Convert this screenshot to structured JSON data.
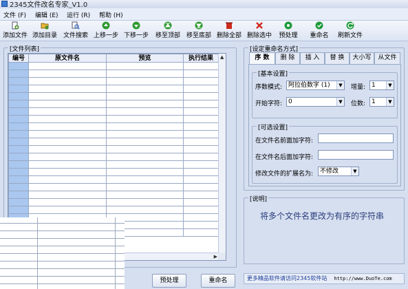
{
  "window": {
    "title": "2345文件改名专家_V1.0"
  },
  "menu": [
    {
      "label": "文件 (F)"
    },
    {
      "label": "编辑 (E)"
    },
    {
      "label": "运行 (R)"
    },
    {
      "label": "帮助 (H)"
    }
  ],
  "toolbar": [
    {
      "label": "添加文件",
      "icon": "add-file-icon",
      "color": "#4a8f2b"
    },
    {
      "label": "添加目录",
      "icon": "add-folder-icon",
      "color": "#d6a22a"
    },
    {
      "label": "文件搜索",
      "icon": "file-search-icon",
      "color": "#3567c4"
    },
    {
      "label": "上移一步",
      "icon": "arrow-up-icon",
      "color": "#2f9a2f"
    },
    {
      "label": "下移一步",
      "icon": "arrow-down-icon",
      "color": "#2f9a2f"
    },
    {
      "label": "移至顶部",
      "icon": "move-top-icon",
      "color": "#2f9a2f"
    },
    {
      "label": "移至底部",
      "icon": "move-bottom-icon",
      "color": "#2f9a2f"
    },
    {
      "label": "删除全部",
      "icon": "delete-all-icon",
      "color": "#cc2a1c"
    },
    {
      "label": "删除选中",
      "icon": "delete-selected-icon",
      "color": "#d0291f"
    },
    {
      "label": "预处理",
      "icon": "preprocess-icon",
      "color": "#1e9a3a"
    },
    {
      "label": "重命名",
      "icon": "rename-icon",
      "color": "#1e9a3a"
    },
    {
      "label": "刷新文件",
      "icon": "refresh-icon",
      "color": "#1e9a3a"
    }
  ],
  "file_list": {
    "title": "[文件列表]",
    "columns": [
      "编号",
      "原文件名",
      "预览",
      "执行结果"
    ]
  },
  "rename_settings": {
    "title": "[设定重命名方式]",
    "tabs": [
      "序 数",
      "删 除",
      "插 入",
      "替 换",
      "大小写",
      "从文件"
    ],
    "basic": {
      "title": "[基本设置]",
      "mode_label": "序数模式:",
      "mode_value": "阿拉伯数字 (1)",
      "increment_label": "增量:",
      "increment_value": "1",
      "start_label": "开始字符:",
      "start_value": "0",
      "digits_label": "位数:",
      "digits_value": "1"
    },
    "optional": {
      "title": "[可选设置]",
      "prefix_label": "在文件名前面加字符:",
      "suffix_label": "在文件名后面加字符:",
      "ext_label": "修改文件的扩展名为:",
      "ext_value": "不修改"
    }
  },
  "description": {
    "title": "[说明]",
    "text": "将多个文件名更改为有序的字符串"
  },
  "buttons": {
    "preprocess": "预处理",
    "rename": "重命名"
  },
  "footer": {
    "text": "更多精品软件请访问2345软件站",
    "url": "http://www.DuoTe.com"
  },
  "colors": {
    "index_column": "#a9c7ef",
    "background": "#d6dff0"
  }
}
